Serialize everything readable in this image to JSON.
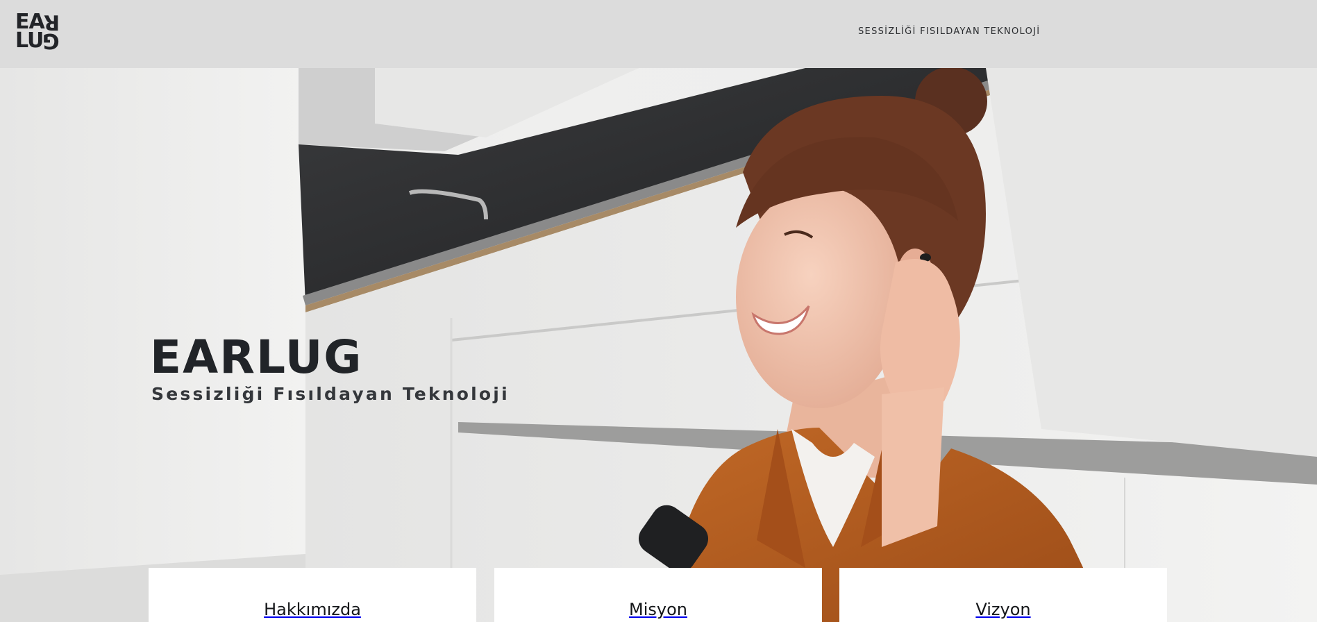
{
  "header": {
    "logo_line1": "EA",
    "logo_line1_flipped": "R",
    "logo_line2": "LU",
    "logo_line2_flipped": "G",
    "nav_tagline": "SESSİZLİĞİ FISILDAYAN TEKNOLOJİ"
  },
  "hero": {
    "title": "EARLUG",
    "subtitle": "Sessizliği Fısıldayan Teknoloji"
  },
  "cards": [
    {
      "label": "Hakkımızda"
    },
    {
      "label": "Misyon"
    },
    {
      "label": "Vizyon"
    }
  ],
  "colors": {
    "header_bg": "#dcdcdc",
    "text_dark": "#212428",
    "card_bg": "#ffffff",
    "shirt": "#b25a1f",
    "hair": "#5a3020"
  }
}
